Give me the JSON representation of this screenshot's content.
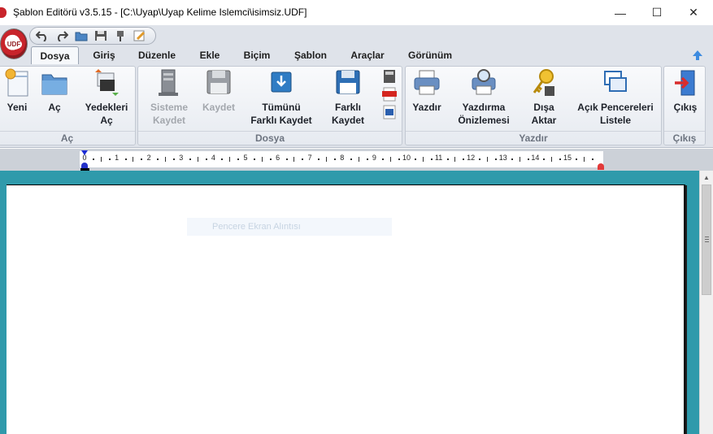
{
  "window": {
    "title": "Şablon Editörü v3.5.15 - [C:\\Uyap\\Uyap Kelime Islemci\\isimsiz.UDF]",
    "controls": {
      "minimize": "—",
      "maximize": "☐",
      "close": "✕"
    }
  },
  "logo": {
    "text": "UDF"
  },
  "quick_access": [
    {
      "name": "undo-icon"
    },
    {
      "name": "redo-icon"
    },
    {
      "name": "open-folder-icon"
    },
    {
      "name": "save-icon"
    },
    {
      "name": "pin-icon"
    },
    {
      "name": "edit-icon"
    }
  ],
  "tabs": [
    {
      "label": "Dosya",
      "active": true
    },
    {
      "label": "Giriş"
    },
    {
      "label": "Düzenle"
    },
    {
      "label": "Ekle"
    },
    {
      "label": "Biçim"
    },
    {
      "label": "Şablon"
    },
    {
      "label": "Araçlar"
    },
    {
      "label": "Görünüm"
    }
  ],
  "ribbon": {
    "groups": {
      "ac": {
        "label": "Aç",
        "buttons": {
          "yeni": "Yeni",
          "ac": "Aç",
          "yedekleri_1": "Yedekleri",
          "yedekleri_2": "Aç"
        }
      },
      "dosya": {
        "label": "Dosya",
        "buttons": {
          "sistemekaydet_1": "Sisteme",
          "sistemekaydet_2": "Kaydet",
          "kaydet": "Kaydet",
          "tumunu_1": "Tümünü",
          "tumunu_2": "Farklı Kaydet",
          "farkli_1": "Farklı",
          "farkli_2": "Kaydet"
        }
      },
      "yazdir": {
        "label": "Yazdır",
        "buttons": {
          "yazdir": "Yazdır",
          "onizleme_1": "Yazdırma",
          "onizleme_2": "Önizlemesi",
          "disa_1": "Dışa",
          "disa_2": "Aktar",
          "pencereler_1": "Açık Pencereleri",
          "pencereler_2": "Listele"
        }
      },
      "cikis": {
        "label": "Çıkış",
        "buttons": {
          "cikis": "Çıkış"
        }
      }
    }
  },
  "ruler": {
    "numbers": [
      "0",
      "1",
      "2",
      "3",
      "4",
      "5",
      "6",
      "7",
      "8",
      "9",
      "10",
      "11",
      "12",
      "13",
      "14",
      "15"
    ]
  },
  "document": {
    "faint_overlay": "Pencere Ekran Alıntısı"
  },
  "colors": {
    "workspace": "#2f9aab",
    "accent_red": "#c8242b",
    "ribbon_bg": "#dfe3ea"
  }
}
